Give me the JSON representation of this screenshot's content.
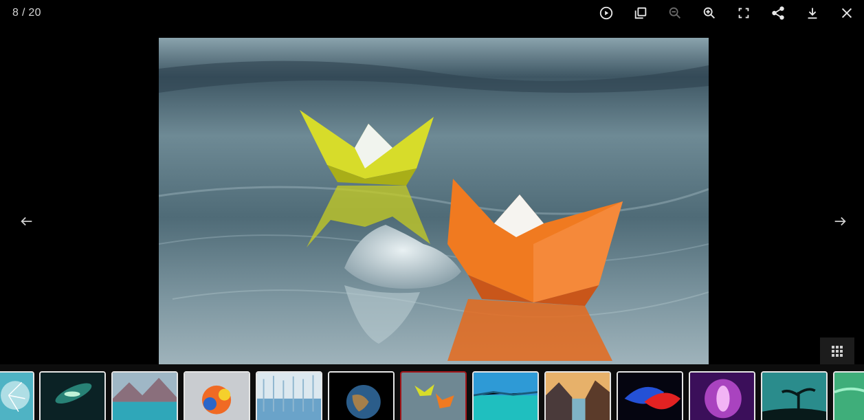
{
  "viewer": {
    "counter": "8 / 20",
    "current_index": 8,
    "total": 20
  },
  "toolbar": {
    "buttons": [
      {
        "name": "play-slideshow-button",
        "icon": "play-circle-icon"
      },
      {
        "name": "thumbnails-button",
        "icon": "copy-icon"
      },
      {
        "name": "zoom-out-button",
        "icon": "zoom-out-icon",
        "disabled": true
      },
      {
        "name": "zoom-in-button",
        "icon": "zoom-in-icon"
      },
      {
        "name": "fullscreen-button",
        "icon": "fullscreen-icon"
      },
      {
        "name": "share-button",
        "icon": "share-icon"
      },
      {
        "name": "download-button",
        "icon": "download-icon"
      },
      {
        "name": "close-button",
        "icon": "close-icon"
      }
    ]
  },
  "navigation": {
    "prev_icon": "arrow-left-icon",
    "next_icon": "arrow-right-icon"
  },
  "main_image": {
    "subject": "paper-boats-on-water"
  },
  "thumbnails": {
    "active_index": 6,
    "items": [
      {
        "name": "dandelion"
      },
      {
        "name": "galaxy-swirl"
      },
      {
        "name": "mountain-lake"
      },
      {
        "name": "color-explosion"
      },
      {
        "name": "winter-forest"
      },
      {
        "name": "earth-globe"
      },
      {
        "name": "paper-boats"
      },
      {
        "name": "tropical-water"
      },
      {
        "name": "sunset-fjord"
      },
      {
        "name": "red-blue-splash"
      },
      {
        "name": "purple-aurora"
      },
      {
        "name": "tree-silhouette"
      },
      {
        "name": "green-waves"
      }
    ]
  },
  "colors": {
    "background": "#000000",
    "active_border": "#a3161a",
    "thumb_border": "#e6e6e6"
  }
}
